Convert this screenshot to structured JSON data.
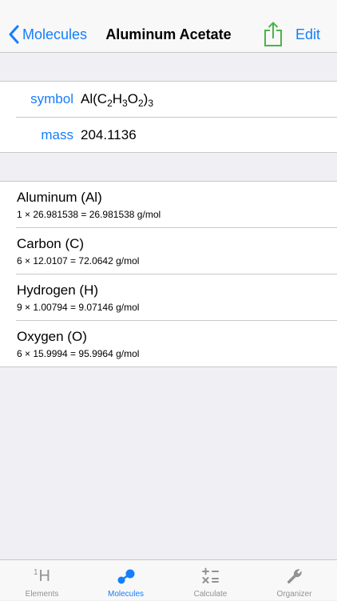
{
  "nav": {
    "back_label": "Molecules",
    "title": "Aluminum Acetate",
    "edit_label": "Edit"
  },
  "properties": {
    "symbol_label": "symbol",
    "symbol_parts": [
      "Al(C",
      "2",
      "H",
      "3",
      "O",
      "2",
      ")",
      "3"
    ],
    "mass_label": "mass",
    "mass_value": "204.1136"
  },
  "elements": [
    {
      "name": "Aluminum (Al)",
      "calc": "1 × 26.981538 = 26.981538 g/mol"
    },
    {
      "name": "Carbon (C)",
      "calc": "6 × 12.0107 = 72.0642 g/mol"
    },
    {
      "name": "Hydrogen (H)",
      "calc": "9 × 1.00794 = 9.07146 g/mol"
    },
    {
      "name": "Oxygen (O)",
      "calc": "6 × 15.9994 = 95.9964 g/mol"
    }
  ],
  "tabs": [
    {
      "label": "Elements",
      "icon": "hydrogen-element-icon",
      "icon_text": "H",
      "icon_sup": "1"
    },
    {
      "label": "Molecules",
      "icon": "molecule-icon"
    },
    {
      "label": "Calculate",
      "icon": "calculator-icon"
    },
    {
      "label": "Organizer",
      "icon": "wrench-icon"
    }
  ],
  "colors": {
    "accent": "#157efb",
    "share_green": "#4cb34a",
    "tab_inactive": "#929292",
    "background": "#efeff4"
  }
}
